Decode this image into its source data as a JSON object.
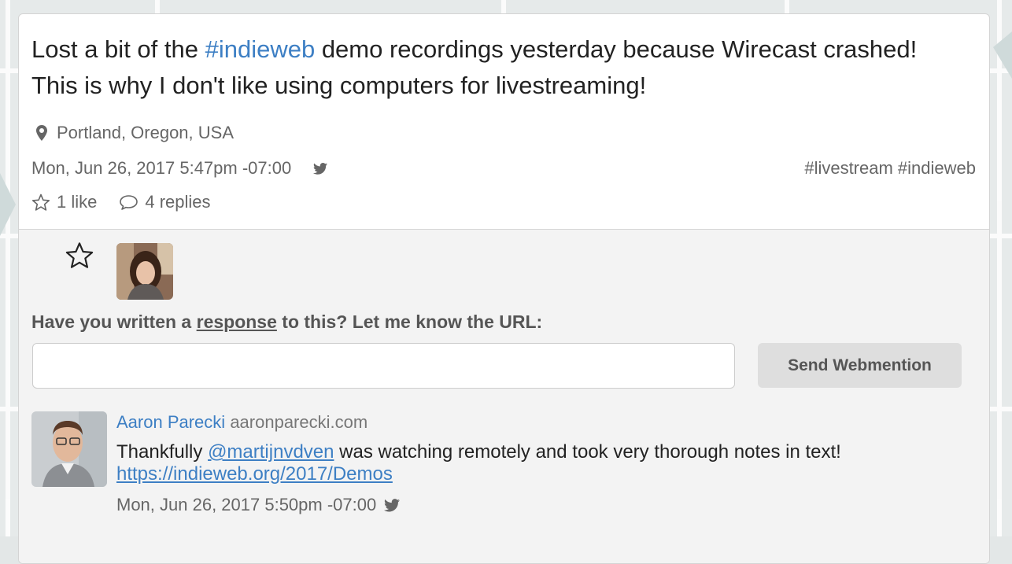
{
  "note": {
    "text_before": "Lost a bit of the ",
    "hashtag": "#indieweb",
    "text_after": " demo recordings yesterday because Wirecast crashed! This is why I don't like using computers for livestreaming!",
    "location": "Portland, Oregon, USA",
    "published": "Mon, Jun 26, 2017 5:47pm -07:00",
    "syndication_icon": "twitter-icon",
    "tags": "#livestream #indieweb"
  },
  "actions": {
    "likes_label": "1 like",
    "replies_label": "4 replies"
  },
  "webmention": {
    "prompt_before": "Have you written a ",
    "prompt_link": "response",
    "prompt_after": " to this? Let me know the URL:",
    "input_value": "",
    "button_label": "Send Webmention"
  },
  "reply": {
    "author_name": "Aaron Parecki",
    "author_url": "aaronparecki.com",
    "text_before": "Thankfully ",
    "mention": "@martijnvdven",
    "text_after": " was watching remotely and took very thorough notes in text!",
    "link": "https://indieweb.org/2017/Demos",
    "published": "Mon, Jun 26, 2017 5:50pm -07:00",
    "syndication_icon": "twitter-icon"
  },
  "colors": {
    "link": "#3d7fc4",
    "meta_text": "#666666",
    "responses_bg": "#f3f3f3",
    "button_bg": "#dedede"
  }
}
